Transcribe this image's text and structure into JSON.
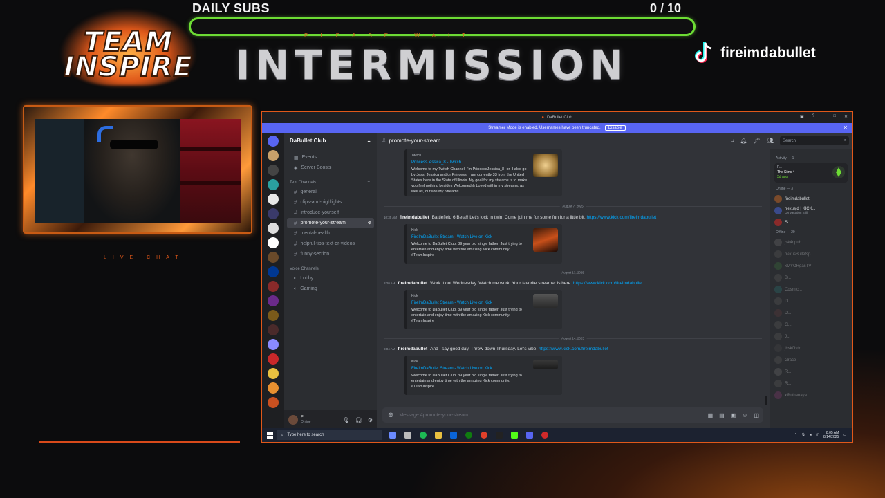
{
  "overlay": {
    "logo_line1": "TEAM",
    "logo_line2": "INSPIRE",
    "subs_title": "DAILY SUBS",
    "subs_count": "0  / 10",
    "subs_progress": 0,
    "please_wait": "PLEASE WAIT...",
    "intermission": "INTERMISSION",
    "tiktok_handle": "fireimdabullet",
    "live_chat": "LIVE CHAT",
    "accent_color": "#e0581a",
    "bar_color": "#6ddc34"
  },
  "discord": {
    "window_title": "DaBullet Club",
    "streamer_notice": "Streamer Mode is enabled. Usernames have been truncated.",
    "disable_label": "Disable",
    "server_name": "DaBullet Club",
    "top_items": [
      "Events",
      "Server Boosts"
    ],
    "text_category": "Text Channels",
    "text_channels": [
      "general",
      "clips-and-highlights",
      "introduce-yourself",
      "promote-your-stream",
      "mental-health",
      "helpful-tips-text-or-videos",
      "funny-section"
    ],
    "voice_category": "Voice Channels",
    "voice_channels": [
      "Lobby",
      "Gaming"
    ],
    "user_panel": {
      "name": "F...",
      "status": "Online"
    },
    "channel_header": "promote-your-stream",
    "search_placeholder": "Search",
    "composer_placeholder": "Message #promote-your-stream",
    "embed0": {
      "provider": "Twitch",
      "title": "PrincessJessica_8 - Twitch",
      "desc": "Welcome to my Twitch Channel! I'm PrincessJessica_8 -or- I also go by Jess, Jessica and/or Princess, I am currently 33 from the United States here in the State of Illinois. My goal for my streams is to make you feel nothing besides Welcomed & Loved within my streams, as well as, outside My Streams"
    },
    "messages": [
      {
        "date": "August 7, 2025",
        "time": "10:35 AM",
        "author": "fireimdabullet",
        "text": "Battlefield 6 Beta!! Let's lock in twin. Come join me for some fun for a little bit.",
        "link": "https://www.kick.com/fireimdabullet",
        "embed_provider": "Kick",
        "embed_title": "FireImDaBullet Stream - Watch Live on Kick",
        "embed_desc": "Welcome to DaBullet Club. 39 year old single father. Just trying to entertain and enjoy time with the amazing Kick community. #TeamInspire"
      },
      {
        "date": "August 13, 2025",
        "time": "8:20 AM",
        "author": "fireimdabullet",
        "text": "Work it out Wednesday. Watch me work. Your favorite streamer is here.",
        "link": "https://www.kick.com/fireimdabullet",
        "embed_provider": "Kick",
        "embed_title": "FireImDaBullet Stream - Watch Live on Kick",
        "embed_desc": "Welcome to DaBullet Club. 39 year old single father. Just trying to entertain and enjoy time with the amazing Kick community. #TeamInspire"
      },
      {
        "date": "August 14, 2025",
        "time": "8:04 AM",
        "author": "fireimdabullet",
        "text": "And I say good day. Throw down Thursday. Let's vibe.",
        "link": "https://www.kick.com/fireimdabullet",
        "embed_provider": "Kick",
        "embed_title": "FireImDaBullet Stream - Watch Live on Kick",
        "embed_desc": "Welcome to DaBullet Club. 39 year old single father. Just trying to entertain and enjoy time with the amazing Kick community. #TeamInspire"
      }
    ],
    "members": {
      "activity_label": "Activity — 1",
      "activity_user": "P...",
      "activity_game": "The Sims 4",
      "activity_time": "3d ago",
      "online_label": "Online — 3",
      "online": [
        {
          "name": "fireimdabullet",
          "sub": "",
          "color": "#7a4a2a"
        },
        {
          "name": "nexusjd | KICK...",
          "sub": "On Vacation Still",
          "color": "#3a4a8a"
        },
        {
          "name": "S...",
          "sub": "",
          "color": "#8a2a2a"
        }
      ],
      "offline_label": "Offline — 29",
      "offline": [
        {
          "name": "jsk4npub",
          "color": "#666"
        },
        {
          "name": "nexusBulletsp...",
          "color": "#555"
        },
        {
          "name": "xMYORgasTV",
          "color": "#3a6a3a"
        },
        {
          "name": "B...",
          "color": "#555"
        },
        {
          "name": "Cosmic...",
          "color": "#2a6a6a"
        },
        {
          "name": "D...",
          "color": "#555"
        },
        {
          "name": "D...",
          "color": "#5a3a3a"
        },
        {
          "name": "G...",
          "color": "#555"
        },
        {
          "name": "J...",
          "color": "#555"
        },
        {
          "name": "jbsk0bdo",
          "color": "#444"
        },
        {
          "name": "Grace",
          "color": "#555"
        },
        {
          "name": "R...",
          "color": "#666"
        },
        {
          "name": "R...",
          "color": "#555"
        },
        {
          "name": "xRuthanaya...",
          "color": "#7a3a6a"
        }
      ]
    },
    "taskbar": {
      "search_placeholder": "Type here to search",
      "time": "8:05 AM",
      "date": "8/14/2025"
    }
  }
}
